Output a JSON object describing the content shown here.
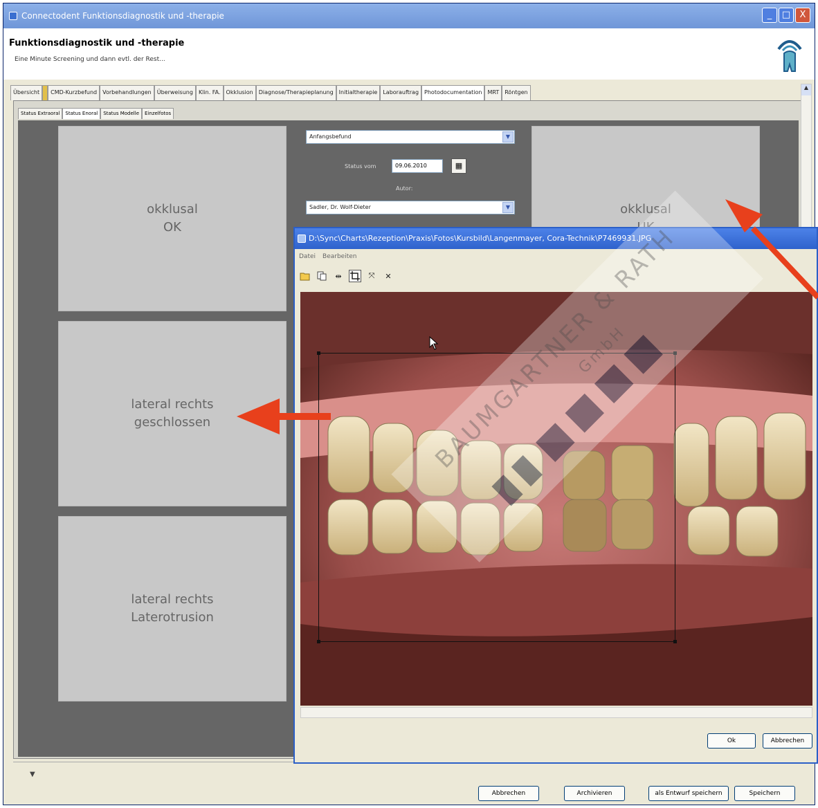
{
  "window": {
    "title": "Connectodent Funktionsdiagnostik und -therapie",
    "btn_min": "_",
    "btn_max": "□",
    "btn_close": "X"
  },
  "header": {
    "title": "Funktionsdiagnostik und -therapie",
    "subtitle": "Eine Minute Screening und dann evtl. der Rest..."
  },
  "tabs": [
    {
      "label": "Übersicht"
    },
    {
      "label": ""
    },
    {
      "label": "CMD-Kurzbefund"
    },
    {
      "label": "Vorbehandlungen"
    },
    {
      "label": "Überweisung"
    },
    {
      "label": "Klin. FA."
    },
    {
      "label": "Okklusion"
    },
    {
      "label": "Diagnose/Therapieplanung"
    },
    {
      "label": "Initialtherapie"
    },
    {
      "label": "Laborauftrag"
    },
    {
      "label": "Photodocumentation"
    },
    {
      "label": "MRT"
    },
    {
      "label": "Röntgen"
    }
  ],
  "subtabs": [
    {
      "label": "Status Extraoral"
    },
    {
      "label": "Status Enoral"
    },
    {
      "label": "Status Modelle"
    },
    {
      "label": "Einzelfotos"
    }
  ],
  "slots": {
    "left1": {
      "line1": "okklusal",
      "line2": "OK"
    },
    "left2": {
      "line1": "lateral rechts",
      "line2": "geschlossen"
    },
    "left3": {
      "line1": "lateral rechts",
      "line2": "Laterotrusion"
    },
    "right1": {
      "line1": "okklusal",
      "line2": "UK"
    }
  },
  "form": {
    "status_select": "Anfangsbefund",
    "status_date_label": "Status vom",
    "status_date": "09.06.2010",
    "author_label": "Autor:",
    "author_select": "Sadler, Dr. Wolf-Dieter"
  },
  "dialog": {
    "title": "D:\\Sync\\Charts\\Rezeption\\Praxis\\Fotos\\Kursbild\\Langenmayer, Cora-Technik\\P7469931.JPG",
    "menu": [
      "Datei",
      "Bearbeiten"
    ],
    "ok": "Ok",
    "cancel": "Abbrechen"
  },
  "bottom_buttons": {
    "cancel": "Abbrechen",
    "archive": "Archivieren",
    "draft": "als Entwurf speichern",
    "save": "Speichern"
  },
  "watermark": {
    "line1": "BAUMGARTNER & RATH",
    "line2": "GmbH"
  },
  "colors": {
    "accent_arrow": "#e8401c",
    "title_blue": "#2f62cc",
    "dark_panel": "#666666"
  }
}
